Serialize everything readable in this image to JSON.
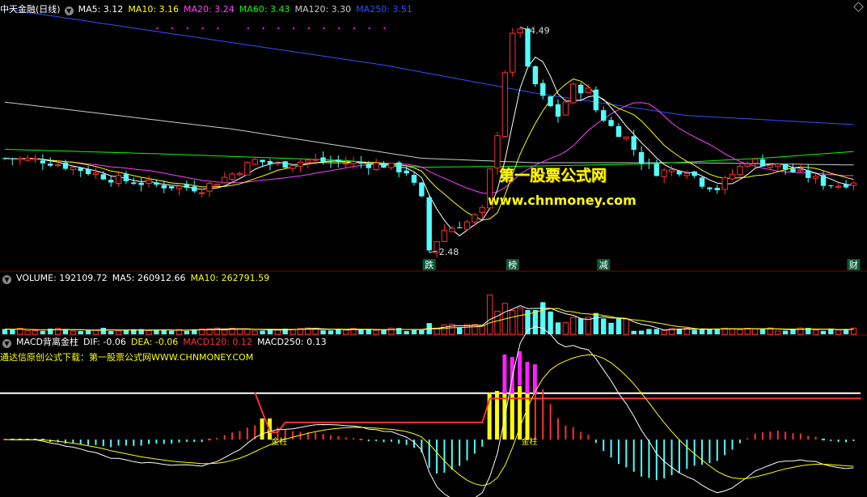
{
  "header": {
    "title": "中天金融(日线)",
    "ma": [
      {
        "label": "MA5: 3.12",
        "color": "#ffffff"
      },
      {
        "label": "MA10: 3.16",
        "color": "#ffff00"
      },
      {
        "label": "MA20: 3.24",
        "color": "#ff40ff"
      },
      {
        "label": "MA60: 3.43",
        "color": "#00ff00"
      },
      {
        "label": "MA120: 3.30",
        "color": "#cccccc"
      },
      {
        "label": "MA250: 3.51",
        "color": "#3050ff"
      }
    ]
  },
  "volume_header": {
    "title": "VOLUME: 192109.72",
    "ma5": "MA5: 260912.66",
    "ma10": "MA10: 262791.59"
  },
  "macd_header": {
    "title": "MACD背离金柱",
    "dif": "DIF: -0.06",
    "dea": "DEA: -0.06",
    "macd120": "MACD120: 0.12",
    "macd250": "MACD250: 0.13"
  },
  "promo_text": "通达信原创公式下载：第一股票公式网WWW.CHNMONEY.COM",
  "watermark": {
    "line1": "第一股票公式网",
    "line2": "www.chnmoney.com"
  },
  "annotations": {
    "high": "4.49",
    "low": "2.48",
    "signal_labels": [
      {
        "text": "跌",
        "bar": 56
      },
      {
        "text": "榜",
        "bar": 67
      },
      {
        "text": "减",
        "bar": 79
      },
      {
        "text": "财",
        "bar": 112
      }
    ],
    "gold_marks": [
      "金柱",
      "金柱"
    ]
  },
  "colors": {
    "up": "#ff3030",
    "down": "#54fcfc",
    "ma5": "#ffffff",
    "ma10": "#ffff00",
    "ma20": "#ff40ff",
    "ma60": "#00ff00",
    "ma120": "#cccccc",
    "ma250": "#3050ff",
    "gold": "#ffff00",
    "magenta": "#ff20ff"
  },
  "chart_data": {
    "type": "candlestick",
    "price_range": [
      2.35,
      4.6
    ],
    "anchors": [
      [
        0,
        3.32
      ],
      [
        5,
        3.3
      ],
      [
        10,
        3.22
      ],
      [
        14,
        3.14
      ],
      [
        20,
        3.08
      ],
      [
        26,
        3.05
      ],
      [
        30,
        3.18
      ],
      [
        33,
        3.3
      ],
      [
        36,
        3.26
      ],
      [
        40,
        3.3
      ],
      [
        45,
        3.28
      ],
      [
        50,
        3.26
      ],
      [
        53,
        3.2
      ],
      [
        55,
        2.95
      ],
      [
        56,
        2.5
      ],
      [
        58,
        2.68
      ],
      [
        61,
        2.75
      ],
      [
        63,
        2.85
      ],
      [
        64,
        3.2
      ],
      [
        65,
        3.55
      ],
      [
        66,
        4.1
      ],
      [
        67,
        4.4
      ],
      [
        68,
        4.49
      ],
      [
        69,
        4.1
      ],
      [
        71,
        3.85
      ],
      [
        73,
        3.7
      ],
      [
        75,
        3.95
      ],
      [
        77,
        3.92
      ],
      [
        78,
        3.75
      ],
      [
        80,
        3.6
      ],
      [
        82,
        3.5
      ],
      [
        84,
        3.3
      ],
      [
        86,
        3.2
      ],
      [
        90,
        3.22
      ],
      [
        92,
        3.1
      ],
      [
        94,
        3.05
      ],
      [
        96,
        3.18
      ],
      [
        98,
        3.3
      ],
      [
        100,
        3.28
      ],
      [
        102,
        3.25
      ],
      [
        104,
        3.2
      ],
      [
        106,
        3.16
      ],
      [
        108,
        3.1
      ],
      [
        110,
        3.08
      ],
      [
        112,
        3.12
      ]
    ],
    "moving_averages": {
      "ma120": [
        [
          0,
          3.82
        ],
        [
          30,
          3.58
        ],
        [
          55,
          3.32
        ],
        [
          70,
          3.28
        ],
        [
          90,
          3.28
        ],
        [
          112,
          3.26
        ]
      ],
      "ma250": [
        [
          0,
          4.65
        ],
        [
          25,
          4.4
        ],
        [
          50,
          4.15
        ],
        [
          70,
          3.9
        ],
        [
          90,
          3.7
        ],
        [
          112,
          3.62
        ]
      ],
      "ma60": [
        [
          0,
          3.4
        ],
        [
          20,
          3.36
        ],
        [
          45,
          3.3
        ],
        [
          55,
          3.24
        ],
        [
          70,
          3.25
        ],
        [
          85,
          3.27
        ],
        [
          100,
          3.32
        ],
        [
          112,
          3.38
        ]
      ]
    },
    "volume_ma": {
      "ma5": "#ffffff",
      "ma10": "#ffff00"
    },
    "macd": {
      "white_line_level": 0.22,
      "red_level_1": 0.035,
      "red_level_2": 0.195
    }
  }
}
